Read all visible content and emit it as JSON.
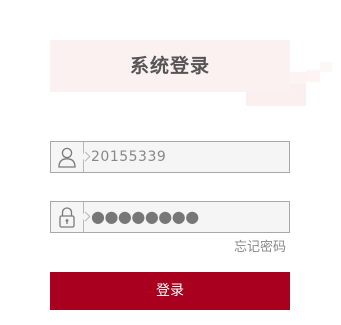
{
  "page": {
    "title": "系统登录"
  },
  "form": {
    "username": {
      "icon": "user-icon",
      "value": "20155339"
    },
    "password": {
      "icon": "lock-icon",
      "value": "●●●●●●●●"
    },
    "forgot_label": "忘记密码",
    "submit_label": "登录"
  },
  "colors": {
    "accent": "#a8001e",
    "banner": "#fbf1f1",
    "field_bg": "#f5f5f5",
    "field_border": "#a8a8a8",
    "text_muted": "#888888"
  }
}
